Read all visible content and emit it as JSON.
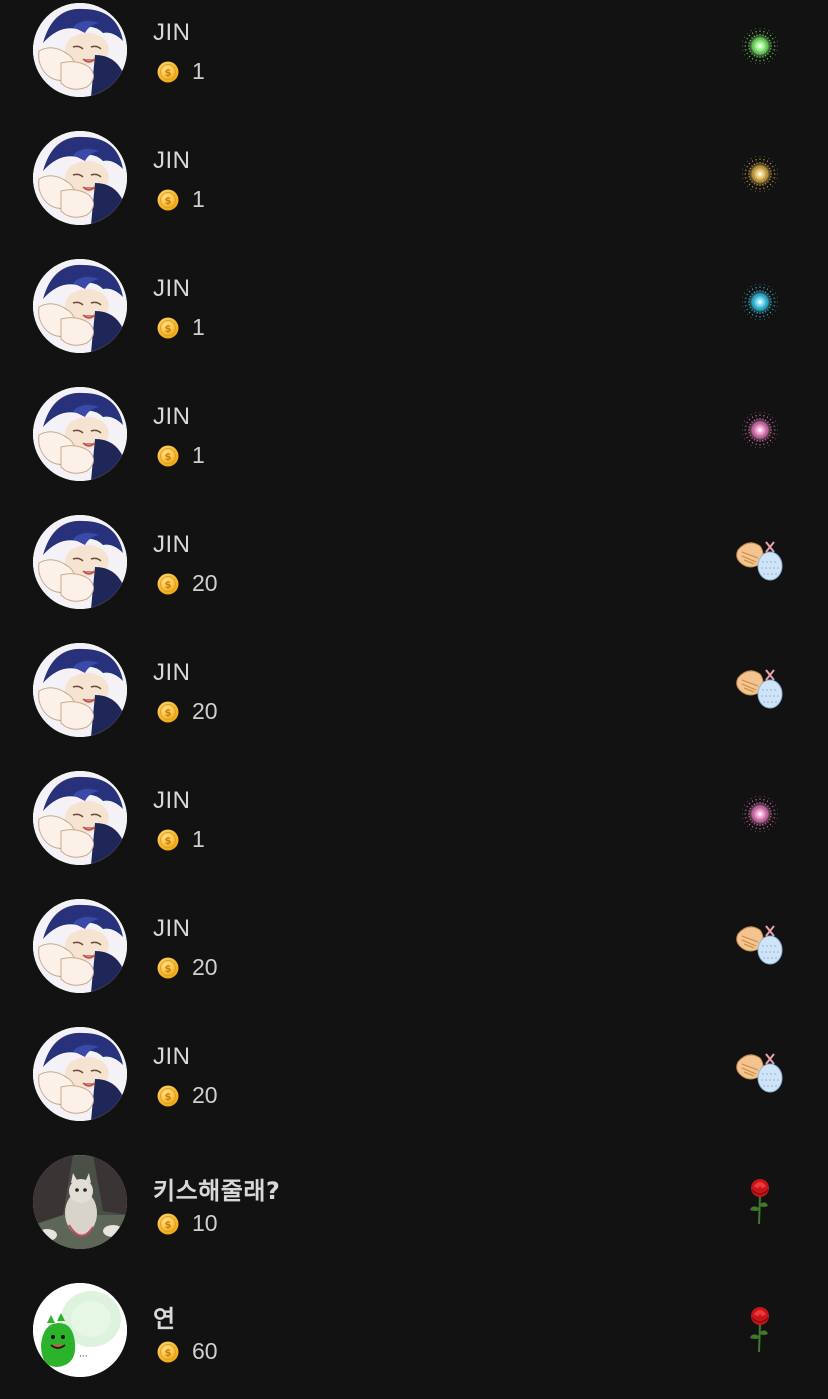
{
  "colors": {
    "background": "#121212",
    "text_primary": "#d8d8d8",
    "coin": "#f5b820"
  },
  "gift_list": {
    "items": [
      {
        "avatar_icon": "anime-boy-avatar",
        "name": "JIN",
        "amount": "1",
        "gift_icon": "green-firework-icon",
        "gift_color": "#7be86a"
      },
      {
        "avatar_icon": "anime-boy-avatar",
        "name": "JIN",
        "amount": "1",
        "gift_icon": "gold-firework-icon",
        "gift_color": "#d8b04a"
      },
      {
        "avatar_icon": "anime-boy-avatar",
        "name": "JIN",
        "amount": "1",
        "gift_icon": "blue-firework-icon",
        "gift_color": "#3ec4e6"
      },
      {
        "avatar_icon": "anime-boy-avatar",
        "name": "JIN",
        "amount": "1",
        "gift_icon": "pink-firework-icon",
        "gift_color": "#e07ab8"
      },
      {
        "avatar_icon": "anime-boy-avatar",
        "name": "JIN",
        "amount": "20",
        "gift_icon": "seashell-icon",
        "gift_color": "#f0c89a"
      },
      {
        "avatar_icon": "anime-boy-avatar",
        "name": "JIN",
        "amount": "20",
        "gift_icon": "seashell-icon",
        "gift_color": "#f0c89a"
      },
      {
        "avatar_icon": "anime-boy-avatar",
        "name": "JIN",
        "amount": "1",
        "gift_icon": "pink-firework-icon",
        "gift_color": "#e07ab8"
      },
      {
        "avatar_icon": "anime-boy-avatar",
        "name": "JIN",
        "amount": "20",
        "gift_icon": "seashell-icon",
        "gift_color": "#f0c89a"
      },
      {
        "avatar_icon": "anime-boy-avatar",
        "name": "JIN",
        "amount": "20",
        "gift_icon": "seashell-icon",
        "gift_color": "#f0c89a"
      },
      {
        "avatar_icon": "cat-photo-avatar",
        "name": "키스해줄래?",
        "amount": "10",
        "gift_icon": "rose-icon",
        "gift_color": "#d01818"
      },
      {
        "avatar_icon": "green-dino-avatar",
        "name": "연",
        "amount": "60",
        "gift_icon": "rose-icon",
        "gift_color": "#d01818"
      }
    ]
  }
}
